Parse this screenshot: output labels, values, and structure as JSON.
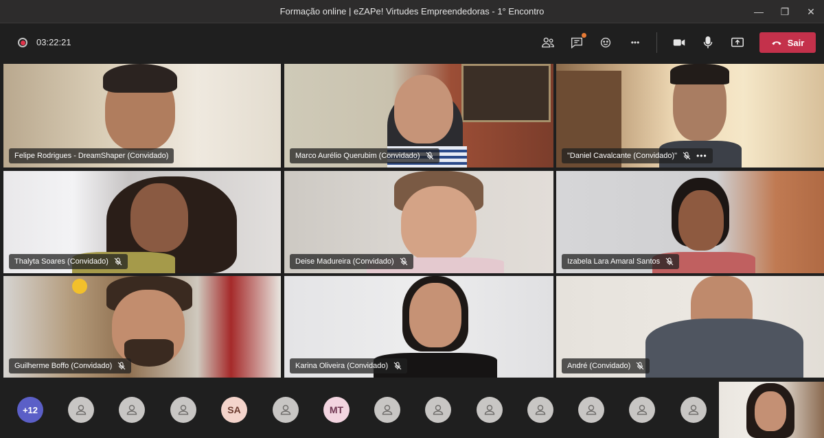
{
  "window": {
    "title": "Formação online | eZAPe! Virtudes Empreendedoras - 1° Encontro",
    "minimize_glyph": "—",
    "restore_glyph": "❐",
    "close_glyph": "✕"
  },
  "toolbar": {
    "recording_icon": "record-icon",
    "elapsed": "03:22:21",
    "icons": [
      "participants-icon",
      "chat-icon",
      "reactions-icon",
      "more-options-icon",
      "camera-icon",
      "microphone-icon",
      "share-screen-icon"
    ],
    "leave_label": "Sair",
    "leave_color": "#c4314b",
    "more_glyph": "•••"
  },
  "tiles": [
    {
      "name": "Felipe Rodrigues - DreamShaper (Convidado)",
      "muted": false,
      "active": false
    },
    {
      "name": "Marco Aurélio Querubim (Convidado)",
      "muted": true,
      "active": false
    },
    {
      "name": "\"Daniel Cavalcante (Convidado)\"",
      "muted": true,
      "active": true,
      "more": "•••"
    },
    {
      "name": "Thalyta Soares (Convidado)",
      "muted": true,
      "active": false
    },
    {
      "name": "Deise Madureira (Convidado)",
      "muted": true,
      "active": false
    },
    {
      "name": "Izabela Lara Amaral Santos",
      "muted": true,
      "active": false
    },
    {
      "name": "Guilherme Boffo (Convidado)",
      "muted": true,
      "active": false
    },
    {
      "name": "Karina Oliveira (Convidado)",
      "muted": true,
      "active": false
    },
    {
      "name": "André (Convidado)",
      "muted": true,
      "active": false
    }
  ],
  "strip": {
    "overflow_count": "+12",
    "initials": [
      "SA",
      "MT"
    ]
  },
  "colors": {
    "accent": "#5b5fc7",
    "background": "#1f1f1f",
    "titlebar": "#2d2c2c"
  }
}
